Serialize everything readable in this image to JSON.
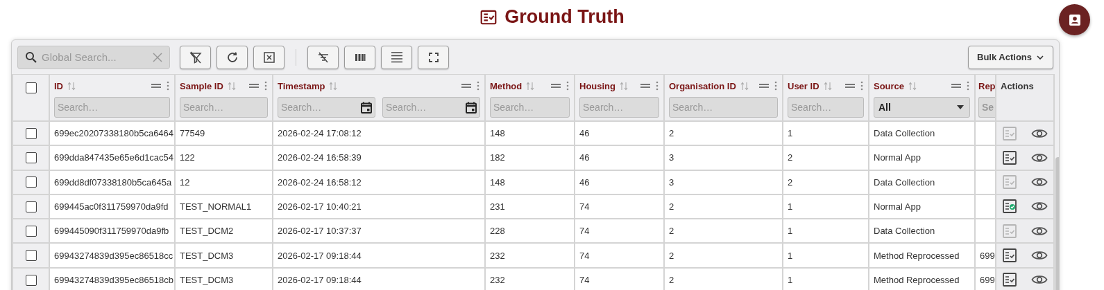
{
  "page_title": "Ground Truth",
  "toolbar": {
    "search_placeholder": "Global Search...",
    "bulk_actions": "Bulk Actions"
  },
  "table": {
    "select_all": {
      "checked": false
    },
    "columns": [
      {
        "label": "ID",
        "kind": "text",
        "placeholder": "Search…"
      },
      {
        "label": "Sample ID",
        "kind": "text",
        "placeholder": "Search…"
      },
      {
        "label": "Timestamp",
        "kind": "daterange",
        "placeholder": "Search…",
        "placeholder_end": "Search…"
      },
      {
        "label": "Method",
        "kind": "text",
        "placeholder": "Search…"
      },
      {
        "label": "Housing",
        "kind": "text",
        "placeholder": "Search…"
      },
      {
        "label": "Organisation ID",
        "kind": "text",
        "placeholder": "Search…"
      },
      {
        "label": "User ID",
        "kind": "text",
        "placeholder": "Search…"
      },
      {
        "label": "Source",
        "kind": "select",
        "value": "All"
      },
      {
        "label": "Rep",
        "kind": "cut",
        "placeholder": "Se"
      }
    ],
    "actions_label": "Actions",
    "rows": [
      {
        "checked": false,
        "cells": [
          "699ec20207338180b5ca6464",
          "77549",
          "2026-02-24 17:08:12",
          "148",
          "46",
          "2",
          "1",
          "Data Collection",
          ""
        ],
        "review_disabled": true,
        "review_done": false
      },
      {
        "checked": false,
        "cells": [
          "699dda847435e65e6d1cac54",
          "122",
          "2026-02-24 16:58:39",
          "182",
          "46",
          "3",
          "2",
          "Normal App",
          ""
        ],
        "review_disabled": false,
        "review_done": false
      },
      {
        "checked": false,
        "cells": [
          "699dd8df07338180b5ca645a",
          "12",
          "2026-02-24 16:58:12",
          "148",
          "46",
          "3",
          "2",
          "Data Collection",
          ""
        ],
        "review_disabled": true,
        "review_done": false
      },
      {
        "checked": false,
        "cells": [
          "699445ac0f311759970da9fd",
          "TEST_NORMAL1",
          "2026-02-17 10:40:21",
          "231",
          "74",
          "2",
          "1",
          "Normal App",
          ""
        ],
        "review_disabled": false,
        "review_done": true
      },
      {
        "checked": false,
        "cells": [
          "699445090f311759970da9fb",
          "TEST_DCM2",
          "2026-02-17 10:37:37",
          "228",
          "74",
          "2",
          "1",
          "Data Collection",
          ""
        ],
        "review_disabled": true,
        "review_done": false
      },
      {
        "checked": false,
        "cells": [
          "69943274839d395ec86518cc",
          "TEST_DCM3",
          "2026-02-17 09:18:44",
          "232",
          "74",
          "2",
          "1",
          "Method Reprocessed",
          "699"
        ],
        "review_disabled": false,
        "review_done": false
      },
      {
        "checked": false,
        "cells": [
          "69943274839d395ec86518cb",
          "TEST_DCM3",
          "2026-02-17 09:18:44",
          "232",
          "74",
          "2",
          "1",
          "Method Reprocessed",
          "699"
        ],
        "review_disabled": false,
        "review_done": false
      }
    ]
  }
}
